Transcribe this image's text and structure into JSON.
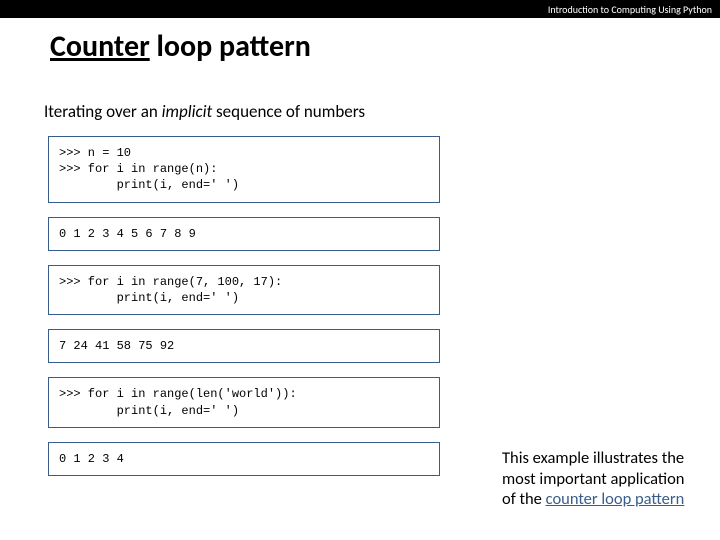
{
  "header": {
    "course": "Introduction to Computing Using Python"
  },
  "title": {
    "underlined": "Counter",
    "rest": " loop pattern"
  },
  "subtitle": {
    "prefix": "Iterating over an ",
    "emph": "implicit",
    "suffix": " sequence of numbers"
  },
  "code": {
    "block1": ">>> n = 10\n>>> for i in range(n):\n        print(i, end=' ')",
    "out1": "0 1 2 3 4 5 6 7 8 9",
    "block2": ">>> for i in range(7, 100, 17):\n        print(i, end=' ')",
    "out2": "7 24 41 58 75 92",
    "block3": ">>> for i in range(len('world')):\n        print(i, end=' ')",
    "out3": "0 1 2 3 4"
  },
  "sidenote": {
    "text": "This example illustrates the most important application of the ",
    "link": "counter loop pattern"
  }
}
